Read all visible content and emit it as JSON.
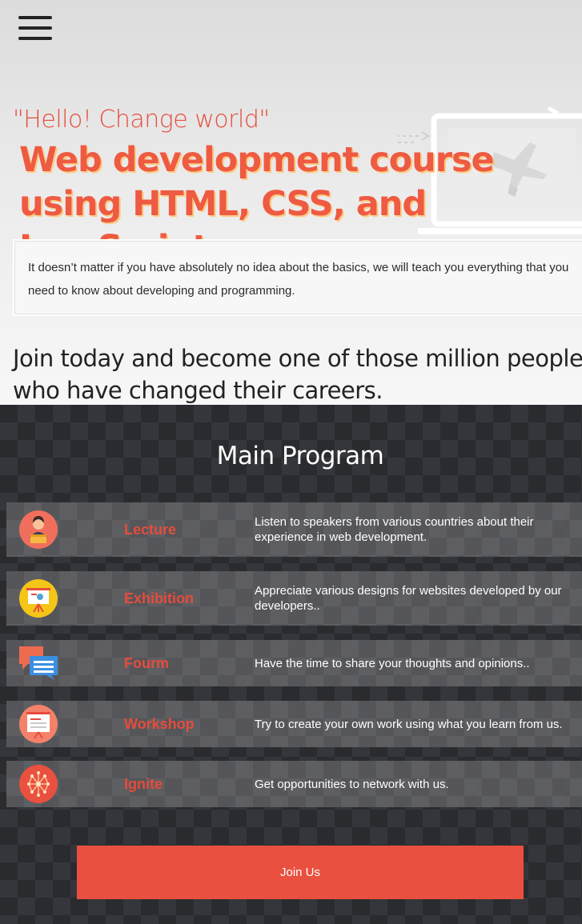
{
  "hero": {
    "tagline": "\"Hello! Change world\"",
    "headline": "Web development course using HTML, CSS, and JavaScript",
    "intro": "It doesn’t matter if you have absolutely no idea about the basics, we will teach you everything that you need to know about developing and programming.",
    "join_text": "Join today and become one of those million people who have changed their careers."
  },
  "program": {
    "title": "Main Program",
    "items": [
      {
        "icon": "speaker-icon",
        "name": "Lecture",
        "desc": "Listen to speakers from various countries about their experience in web development."
      },
      {
        "icon": "presentation-board-icon",
        "name": "Exhibition",
        "desc": "Appreciate various designs for websites developed by our developers.."
      },
      {
        "icon": "chat-bubbles-icon",
        "name": "Fourm",
        "desc": "Have the time to share your thoughts and opinions.."
      },
      {
        "icon": "whiteboard-icon",
        "name": "Workshop",
        "desc": "Try to create your own work using what you learn from us."
      },
      {
        "icon": "network-icon",
        "name": "Ignite",
        "desc": "Get opportunities to network with us."
      }
    ],
    "join_button": "Join Us"
  },
  "colors": {
    "accent": "#e74c3c",
    "button": "#e9503f",
    "dark_bg": "#2b2c30"
  }
}
